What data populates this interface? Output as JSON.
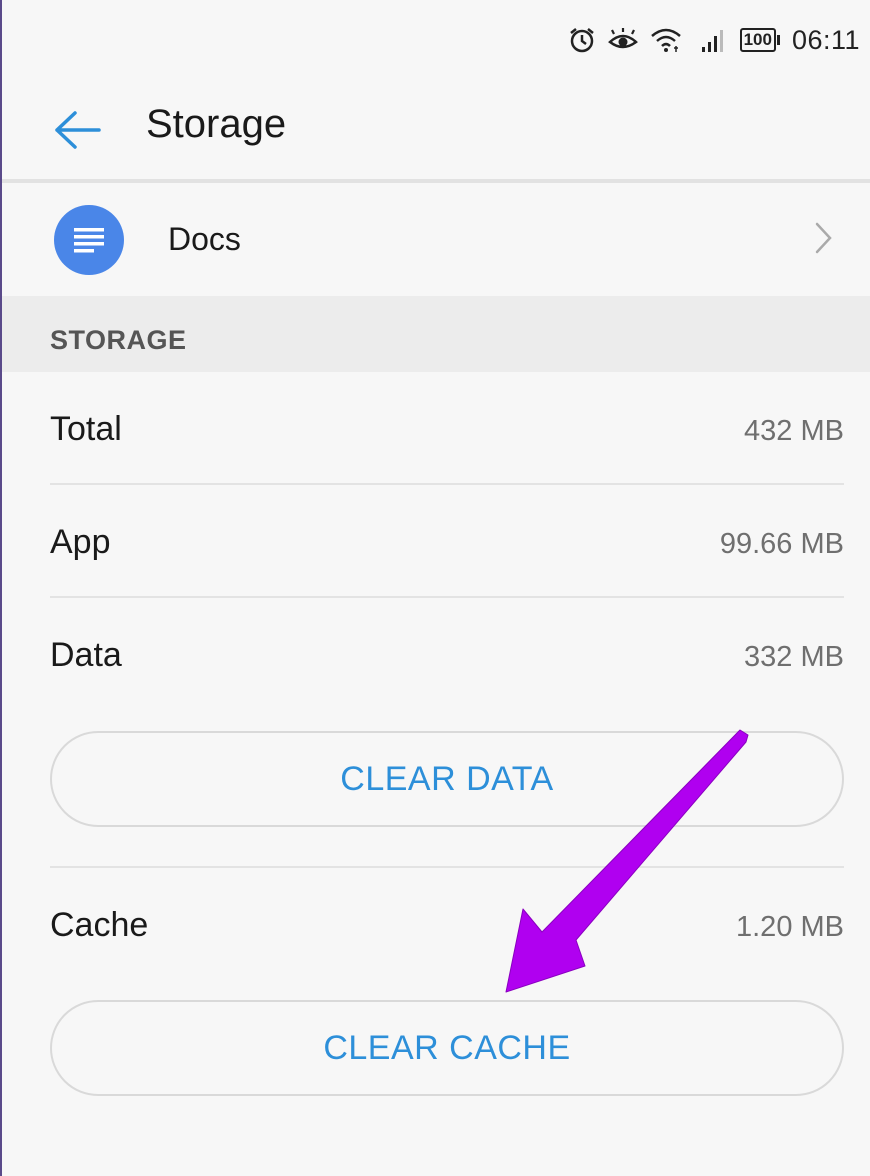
{
  "status_bar": {
    "time": "06:11",
    "battery": "100",
    "icons": [
      "alarm-icon",
      "eye-icon",
      "wifi-icon",
      "signal-icon",
      "battery-icon"
    ]
  },
  "app_bar": {
    "title": "Storage",
    "back_icon": "back-arrow-icon"
  },
  "app": {
    "name": "Docs",
    "icon": "docs-icon",
    "icon_color": "#4a86e8"
  },
  "section": {
    "header": "STORAGE"
  },
  "storage": {
    "total": {
      "label": "Total",
      "value": "432 MB"
    },
    "app": {
      "label": "App",
      "value": "99.66 MB"
    },
    "data": {
      "label": "Data",
      "value": "332 MB"
    },
    "clear_data_label": "CLEAR DATA",
    "cache": {
      "label": "Cache",
      "value": "1.20 MB"
    },
    "clear_cache_label": "CLEAR CACHE"
  },
  "colors": {
    "accent": "#2d8fd9",
    "annotation_arrow": "#b000f0"
  }
}
